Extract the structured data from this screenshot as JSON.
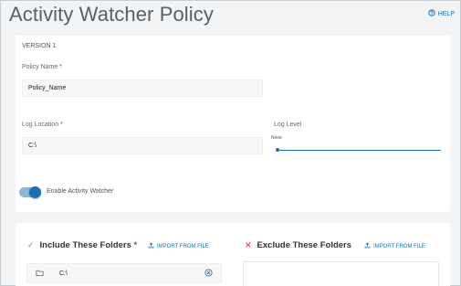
{
  "header": {
    "title": "Activity Watcher Policy",
    "help_label": "HELP"
  },
  "policy": {
    "version_label": "VERSION 1",
    "name_label": "Policy Name",
    "name_required": "*",
    "name_value": "Policy_Name",
    "log_location_label": "Log Location",
    "log_location_required": "*",
    "log_location_value": "C:\\",
    "log_level_label": "Log Level",
    "log_level_value": "None",
    "log_level_fraction": 0,
    "enable_label": "Enable Activity Watcher",
    "enable_on": true
  },
  "include": {
    "title": "Include These Folders",
    "required": "*",
    "import_label": "IMPORT FROM FILE",
    "folders": [
      "C:\\"
    ]
  },
  "exclude": {
    "title": "Exclude These Folders",
    "import_label": "IMPORT FROM FILE",
    "folders": []
  },
  "colors": {
    "accent": "#1a6fb5",
    "required": "#d32f2f",
    "include_check": "#4caf50",
    "exclude_x": "#d32f2f"
  },
  "icons": {
    "help": "help-circle-icon",
    "import": "upload-icon",
    "folder": "folder-icon",
    "remove": "close-circle-icon"
  }
}
